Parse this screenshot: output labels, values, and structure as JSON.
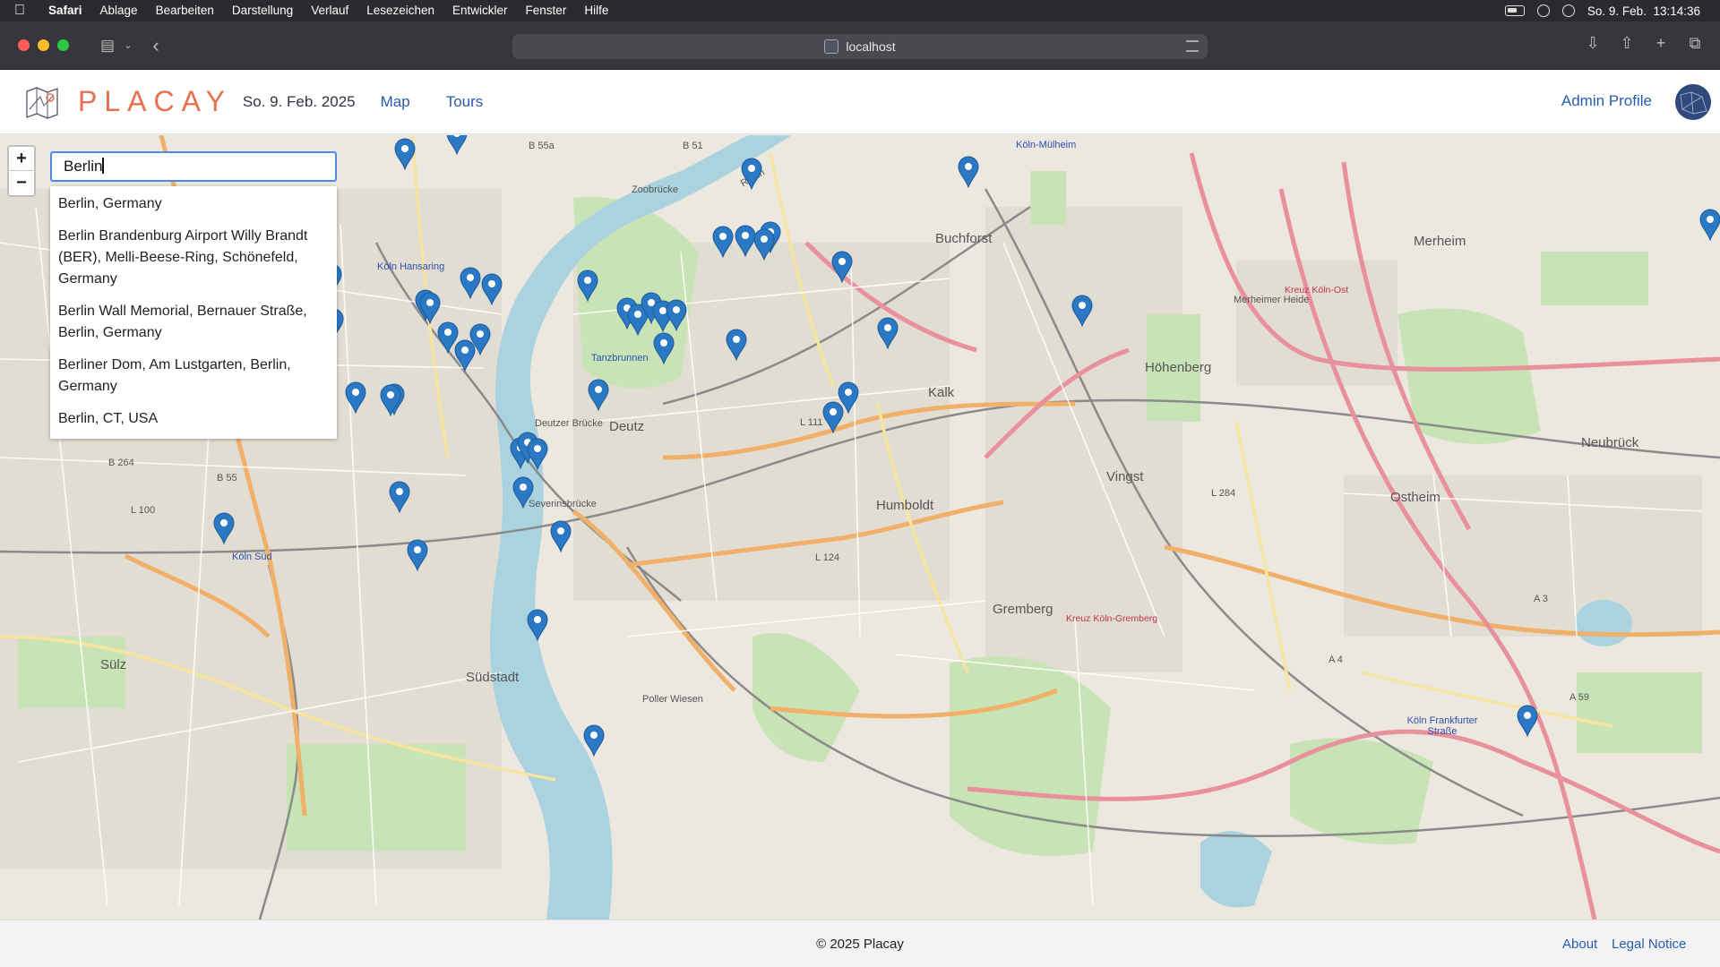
{
  "menubar": {
    "items": [
      "Safari",
      "Ablage",
      "Bearbeiten",
      "Darstellung",
      "Verlauf",
      "Lesezeichen",
      "Entwickler",
      "Fenster",
      "Hilfe"
    ],
    "clock": "So. 9. Feb.  13:14:36"
  },
  "browser": {
    "url": "localhost"
  },
  "header": {
    "brand": "PLACAY",
    "date": "So. 9. Feb. 2025",
    "nav": [
      "Map",
      "Tours"
    ],
    "admin_label": "Admin Profile"
  },
  "map": {
    "zoom_in": "+",
    "zoom_out": "−",
    "search_value": "Berlin",
    "suggestions": [
      "Berlin, Germany",
      "Berlin Brandenburg Airport Willy Brandt (BER), Melli-Beese-Ring, Schönefeld, Germany",
      "Berlin Wall Memorial, Bernauer Straße, Berlin, Germany",
      "Berliner Dom, Am Lustgarten, Berlin, Germany",
      "Berlin, CT, USA"
    ],
    "pin_color": "#2b78c4",
    "labels": {
      "koeln_muelheim": "Köln-Mülheim",
      "zoobruecke": "Zoobrücke",
      "buchforst": "Buchforst",
      "merheim": "Merheim",
      "koeln_hansaring": "Köln Hansaring",
      "tanzbrunnen": "Tanzbrunnen",
      "hohenberg": "Höhenberg",
      "kalk": "Kalk",
      "deutz": "Deutz",
      "deutzer_bruecke": "Deutzer Brücke",
      "neubruck": "Neubrück",
      "vingst": "Vingst",
      "ostheim": "Ostheim",
      "humboldt": "Humboldt",
      "severinsbruecke": "Severinsbrücke",
      "koeln_sued": "Köln Süd",
      "gremberg": "Gremberg",
      "suedstadt": "Südstadt",
      "suelz": "Sülz",
      "koeln_frankfurter_strasse": "Köln Frankfurter Straße",
      "kreuz_koeln_ost": "Kreuz Köln-Ost",
      "kreuz_koeln_gremberg": "Kreuz Köln-Gremberg",
      "poller_wiesen": "Poller Wiesen",
      "merheimer_heide": "Merheimer Heide",
      "rhein": "Rhein",
      "b55a": "B 55a",
      "b51": "B 51",
      "l111": "L 111",
      "l124": "L 124",
      "l284": "L 284",
      "a3": "A 3",
      "a4": "A 4",
      "a59": "A 59",
      "b264": "B 264",
      "l100": "L 100",
      "b55": "B 55"
    }
  },
  "footer": {
    "copyright": "© 2025 Placay",
    "about": "About",
    "legal": "Legal Notice"
  }
}
